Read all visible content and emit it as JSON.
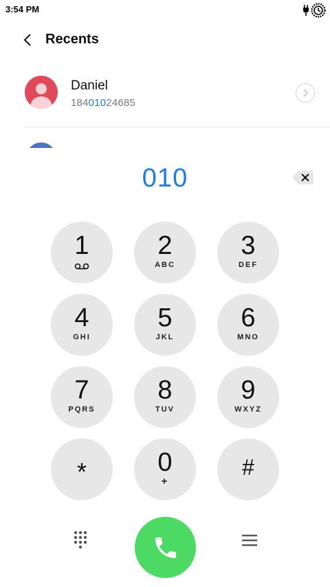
{
  "status_bar": {
    "time": "3:54 PM"
  },
  "header": {
    "title": "Recents"
  },
  "contact": {
    "name": "Daniel",
    "number_prefix": "184",
    "number_match": "010",
    "number_suffix": "24685"
  },
  "dialer": {
    "input": "010",
    "keys": [
      {
        "digit": "1",
        "sub": ""
      },
      {
        "digit": "2",
        "sub": "ABC"
      },
      {
        "digit": "3",
        "sub": "DEF"
      },
      {
        "digit": "4",
        "sub": "GHI"
      },
      {
        "digit": "5",
        "sub": "JKL"
      },
      {
        "digit": "6",
        "sub": "MNO"
      },
      {
        "digit": "7",
        "sub": "PQRS"
      },
      {
        "digit": "8",
        "sub": "TUV"
      },
      {
        "digit": "9",
        "sub": "WXYZ"
      },
      {
        "digit": "*",
        "sub": ""
      },
      {
        "digit": "0",
        "sub": "+"
      },
      {
        "digit": "#",
        "sub": ""
      }
    ]
  },
  "colors": {
    "accent_blue": "#1a7de6",
    "call_green": "#4cd964",
    "key_gray": "#e7e7e7",
    "avatar_red": "#e0495a"
  },
  "icons": {
    "back": "chevron-left-icon",
    "detail": "chevron-right-icon",
    "backspace": "backspace-icon",
    "voicemail": "voicemail-icon",
    "keypad": "keypad-icon",
    "call": "phone-icon",
    "menu": "menu-icon"
  }
}
